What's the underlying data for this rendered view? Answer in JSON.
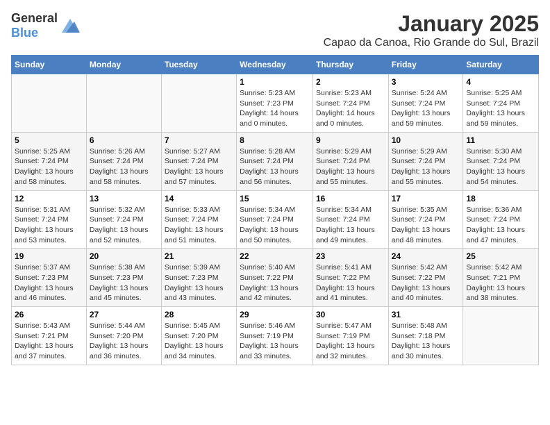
{
  "logo": {
    "general": "General",
    "blue": "Blue"
  },
  "title": "January 2025",
  "subtitle": "Capao da Canoa, Rio Grande do Sul, Brazil",
  "days_of_week": [
    "Sunday",
    "Monday",
    "Tuesday",
    "Wednesday",
    "Thursday",
    "Friday",
    "Saturday"
  ],
  "weeks": [
    [
      {
        "day": "",
        "sunrise": "",
        "sunset": "",
        "daylight": ""
      },
      {
        "day": "",
        "sunrise": "",
        "sunset": "",
        "daylight": ""
      },
      {
        "day": "",
        "sunrise": "",
        "sunset": "",
        "daylight": ""
      },
      {
        "day": "1",
        "sunrise": "Sunrise: 5:23 AM",
        "sunset": "Sunset: 7:23 PM",
        "daylight": "Daylight: 14 hours and 0 minutes."
      },
      {
        "day": "2",
        "sunrise": "Sunrise: 5:23 AM",
        "sunset": "Sunset: 7:24 PM",
        "daylight": "Daylight: 14 hours and 0 minutes."
      },
      {
        "day": "3",
        "sunrise": "Sunrise: 5:24 AM",
        "sunset": "Sunset: 7:24 PM",
        "daylight": "Daylight: 13 hours and 59 minutes."
      },
      {
        "day": "4",
        "sunrise": "Sunrise: 5:25 AM",
        "sunset": "Sunset: 7:24 PM",
        "daylight": "Daylight: 13 hours and 59 minutes."
      }
    ],
    [
      {
        "day": "5",
        "sunrise": "Sunrise: 5:25 AM",
        "sunset": "Sunset: 7:24 PM",
        "daylight": "Daylight: 13 hours and 58 minutes."
      },
      {
        "day": "6",
        "sunrise": "Sunrise: 5:26 AM",
        "sunset": "Sunset: 7:24 PM",
        "daylight": "Daylight: 13 hours and 58 minutes."
      },
      {
        "day": "7",
        "sunrise": "Sunrise: 5:27 AM",
        "sunset": "Sunset: 7:24 PM",
        "daylight": "Daylight: 13 hours and 57 minutes."
      },
      {
        "day": "8",
        "sunrise": "Sunrise: 5:28 AM",
        "sunset": "Sunset: 7:24 PM",
        "daylight": "Daylight: 13 hours and 56 minutes."
      },
      {
        "day": "9",
        "sunrise": "Sunrise: 5:29 AM",
        "sunset": "Sunset: 7:24 PM",
        "daylight": "Daylight: 13 hours and 55 minutes."
      },
      {
        "day": "10",
        "sunrise": "Sunrise: 5:29 AM",
        "sunset": "Sunset: 7:24 PM",
        "daylight": "Daylight: 13 hours and 55 minutes."
      },
      {
        "day": "11",
        "sunrise": "Sunrise: 5:30 AM",
        "sunset": "Sunset: 7:24 PM",
        "daylight": "Daylight: 13 hours and 54 minutes."
      }
    ],
    [
      {
        "day": "12",
        "sunrise": "Sunrise: 5:31 AM",
        "sunset": "Sunset: 7:24 PM",
        "daylight": "Daylight: 13 hours and 53 minutes."
      },
      {
        "day": "13",
        "sunrise": "Sunrise: 5:32 AM",
        "sunset": "Sunset: 7:24 PM",
        "daylight": "Daylight: 13 hours and 52 minutes."
      },
      {
        "day": "14",
        "sunrise": "Sunrise: 5:33 AM",
        "sunset": "Sunset: 7:24 PM",
        "daylight": "Daylight: 13 hours and 51 minutes."
      },
      {
        "day": "15",
        "sunrise": "Sunrise: 5:34 AM",
        "sunset": "Sunset: 7:24 PM",
        "daylight": "Daylight: 13 hours and 50 minutes."
      },
      {
        "day": "16",
        "sunrise": "Sunrise: 5:34 AM",
        "sunset": "Sunset: 7:24 PM",
        "daylight": "Daylight: 13 hours and 49 minutes."
      },
      {
        "day": "17",
        "sunrise": "Sunrise: 5:35 AM",
        "sunset": "Sunset: 7:24 PM",
        "daylight": "Daylight: 13 hours and 48 minutes."
      },
      {
        "day": "18",
        "sunrise": "Sunrise: 5:36 AM",
        "sunset": "Sunset: 7:24 PM",
        "daylight": "Daylight: 13 hours and 47 minutes."
      }
    ],
    [
      {
        "day": "19",
        "sunrise": "Sunrise: 5:37 AM",
        "sunset": "Sunset: 7:23 PM",
        "daylight": "Daylight: 13 hours and 46 minutes."
      },
      {
        "day": "20",
        "sunrise": "Sunrise: 5:38 AM",
        "sunset": "Sunset: 7:23 PM",
        "daylight": "Daylight: 13 hours and 45 minutes."
      },
      {
        "day": "21",
        "sunrise": "Sunrise: 5:39 AM",
        "sunset": "Sunset: 7:23 PM",
        "daylight": "Daylight: 13 hours and 43 minutes."
      },
      {
        "day": "22",
        "sunrise": "Sunrise: 5:40 AM",
        "sunset": "Sunset: 7:22 PM",
        "daylight": "Daylight: 13 hours and 42 minutes."
      },
      {
        "day": "23",
        "sunrise": "Sunrise: 5:41 AM",
        "sunset": "Sunset: 7:22 PM",
        "daylight": "Daylight: 13 hours and 41 minutes."
      },
      {
        "day": "24",
        "sunrise": "Sunrise: 5:42 AM",
        "sunset": "Sunset: 7:22 PM",
        "daylight": "Daylight: 13 hours and 40 minutes."
      },
      {
        "day": "25",
        "sunrise": "Sunrise: 5:42 AM",
        "sunset": "Sunset: 7:21 PM",
        "daylight": "Daylight: 13 hours and 38 minutes."
      }
    ],
    [
      {
        "day": "26",
        "sunrise": "Sunrise: 5:43 AM",
        "sunset": "Sunset: 7:21 PM",
        "daylight": "Daylight: 13 hours and 37 minutes."
      },
      {
        "day": "27",
        "sunrise": "Sunrise: 5:44 AM",
        "sunset": "Sunset: 7:20 PM",
        "daylight": "Daylight: 13 hours and 36 minutes."
      },
      {
        "day": "28",
        "sunrise": "Sunrise: 5:45 AM",
        "sunset": "Sunset: 7:20 PM",
        "daylight": "Daylight: 13 hours and 34 minutes."
      },
      {
        "day": "29",
        "sunrise": "Sunrise: 5:46 AM",
        "sunset": "Sunset: 7:19 PM",
        "daylight": "Daylight: 13 hours and 33 minutes."
      },
      {
        "day": "30",
        "sunrise": "Sunrise: 5:47 AM",
        "sunset": "Sunset: 7:19 PM",
        "daylight": "Daylight: 13 hours and 32 minutes."
      },
      {
        "day": "31",
        "sunrise": "Sunrise: 5:48 AM",
        "sunset": "Sunset: 7:18 PM",
        "daylight": "Daylight: 13 hours and 30 minutes."
      },
      {
        "day": "",
        "sunrise": "",
        "sunset": "",
        "daylight": ""
      }
    ]
  ]
}
